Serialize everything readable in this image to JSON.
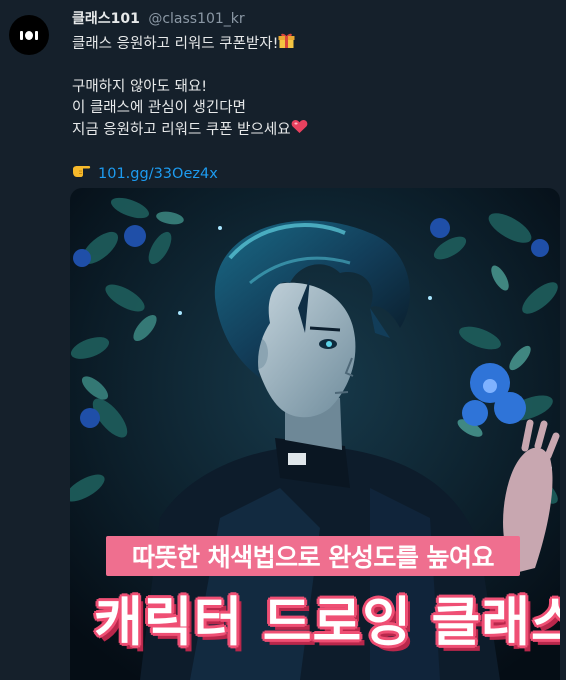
{
  "tweet": {
    "author_name": "클래스101",
    "author_handle": "@class101_kr",
    "lines": [
      "클래스 응원하고 리워드 쿠폰받자!",
      "구매하지 않아도 돼요!",
      "이 클래스에 관심이 생긴다면",
      "지금 응원하고 리워드 쿠폰 받으세요"
    ],
    "link": "101.gg/33Oez4x"
  },
  "media": {
    "banner_text": "따뜻한 채색법으로 완성도를 높여요",
    "title_text": "캐릭터 드로잉 클래스"
  },
  "colors": {
    "background": "#15202b",
    "link": "#1d9bf0",
    "banner": "#ef6f8f"
  },
  "icons": [
    "class101-logo",
    "gift-icon",
    "heart-icon",
    "pointing-hand-icon"
  ]
}
